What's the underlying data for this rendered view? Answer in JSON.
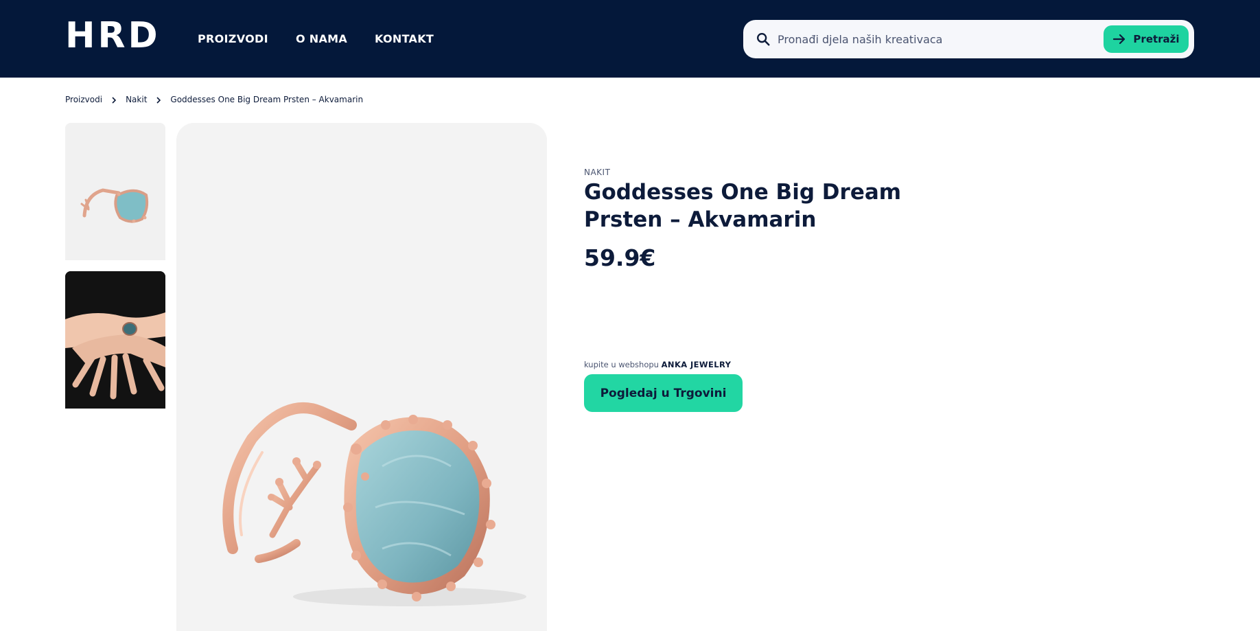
{
  "header": {
    "logo": "HRD",
    "nav": [
      "PROIZVODI",
      "O NAMA",
      "KONTAKT"
    ],
    "search": {
      "placeholder": "Pronađi djela naših kreativaca",
      "button_label": "Pretraži"
    }
  },
  "breadcrumb": [
    "Proizvodi",
    "Nakit",
    "Goddesses One Big Dream Prsten – Akvamarin"
  ],
  "product": {
    "category": "NAKIT",
    "title_line1": "Goddesses One Big Dream",
    "title_line2": "Prsten – Akvamarin",
    "price": "59.9€",
    "shop_prefix": "kupite u webshopu",
    "shop_name": "ANKA JEWELRY",
    "shop_button": "Pogledaj u Trgovini"
  },
  "colors": {
    "header_bg": "#04183a",
    "accent": "#1ed3a0",
    "text": "#0d1b3a"
  }
}
